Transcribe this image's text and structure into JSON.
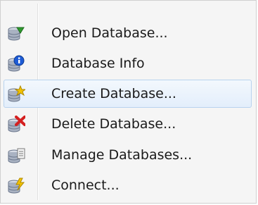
{
  "menu": {
    "items": [
      {
        "label": "Open Database...",
        "icon": "open-database-icon",
        "badge_color": "#2f9a2f"
      },
      {
        "label": "Database Info",
        "icon": "database-info-icon",
        "badge_color": "#1d5bd6"
      },
      {
        "label": "Create Database...",
        "icon": "create-database-icon",
        "badge_color": "#f2c200"
      },
      {
        "label": "Delete Database...",
        "icon": "delete-database-icon",
        "badge_color": "#d42020"
      },
      {
        "label": "Manage Databases...",
        "icon": "manage-databases-icon",
        "badge_color": "#7a7a7a"
      },
      {
        "label": "Connect...",
        "icon": "connect-icon",
        "badge_color": "#f2c200"
      }
    ],
    "hovered_index": 2,
    "colors": {
      "cylinder_top": "#d8dde6",
      "cylinder_body": "#a9b2c2",
      "cylinder_dark": "#6b778c"
    }
  }
}
